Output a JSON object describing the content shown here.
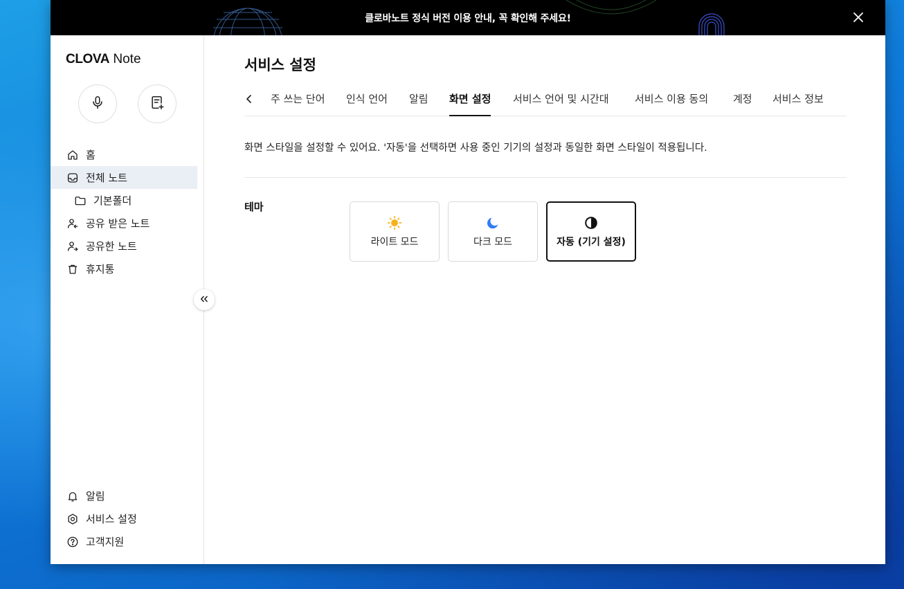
{
  "banner": {
    "text": "클로바노트 정식 버전 이용 안내, 꼭 확인해 주세요!",
    "close_icon": "close-icon"
  },
  "sidebar": {
    "logo_bold": "CLOVA",
    "logo_rest": " Note",
    "mic_icon": "microphone-icon",
    "new_note_icon": "new-note-icon",
    "nav": [
      {
        "label": "홈",
        "icon": "home-icon"
      },
      {
        "label": "전체 노트",
        "icon": "inbox-icon",
        "active": true
      },
      {
        "label": "기본폴더",
        "icon": "folder-icon"
      },
      {
        "label": "공유 받은 노트",
        "icon": "shared-in-icon"
      },
      {
        "label": "공유한 노트",
        "icon": "shared-out-icon"
      },
      {
        "label": "휴지통",
        "icon": "trash-icon"
      }
    ],
    "bottom": [
      {
        "label": "알림",
        "icon": "bell-icon"
      },
      {
        "label": "서비스 설정",
        "icon": "gear-icon"
      },
      {
        "label": "고객지원",
        "icon": "help-icon"
      }
    ],
    "collapse_icon": "collapse-double-chevron-icon"
  },
  "main": {
    "title": "서비스 설정",
    "tabs": [
      {
        "label": "주 쓰는 단어"
      },
      {
        "label": "인식 언어"
      },
      {
        "label": "알림"
      },
      {
        "label": "화면 설정",
        "active": true
      },
      {
        "label": "서비스 언어 및 시간대"
      },
      {
        "label": "서비스 이용 동의"
      },
      {
        "label": "계정"
      },
      {
        "label": "서비스 정보"
      }
    ],
    "description": "화면 스타일을 설정할 수 있어요. '자동'을 선택하면 사용 중인 기기의 설정과 동일한 화면 스타일이 적용됩니다.",
    "theme_label": "테마",
    "themes": [
      {
        "label": "라이트 모드",
        "icon": "sun-icon",
        "color": "#f5b21b"
      },
      {
        "label": "다크 모드",
        "icon": "moon-icon",
        "color": "#2f7cf6"
      },
      {
        "label": "자동 (기기 설정)",
        "icon": "half-circle-icon",
        "color": "#111111",
        "selected": true
      }
    ]
  }
}
